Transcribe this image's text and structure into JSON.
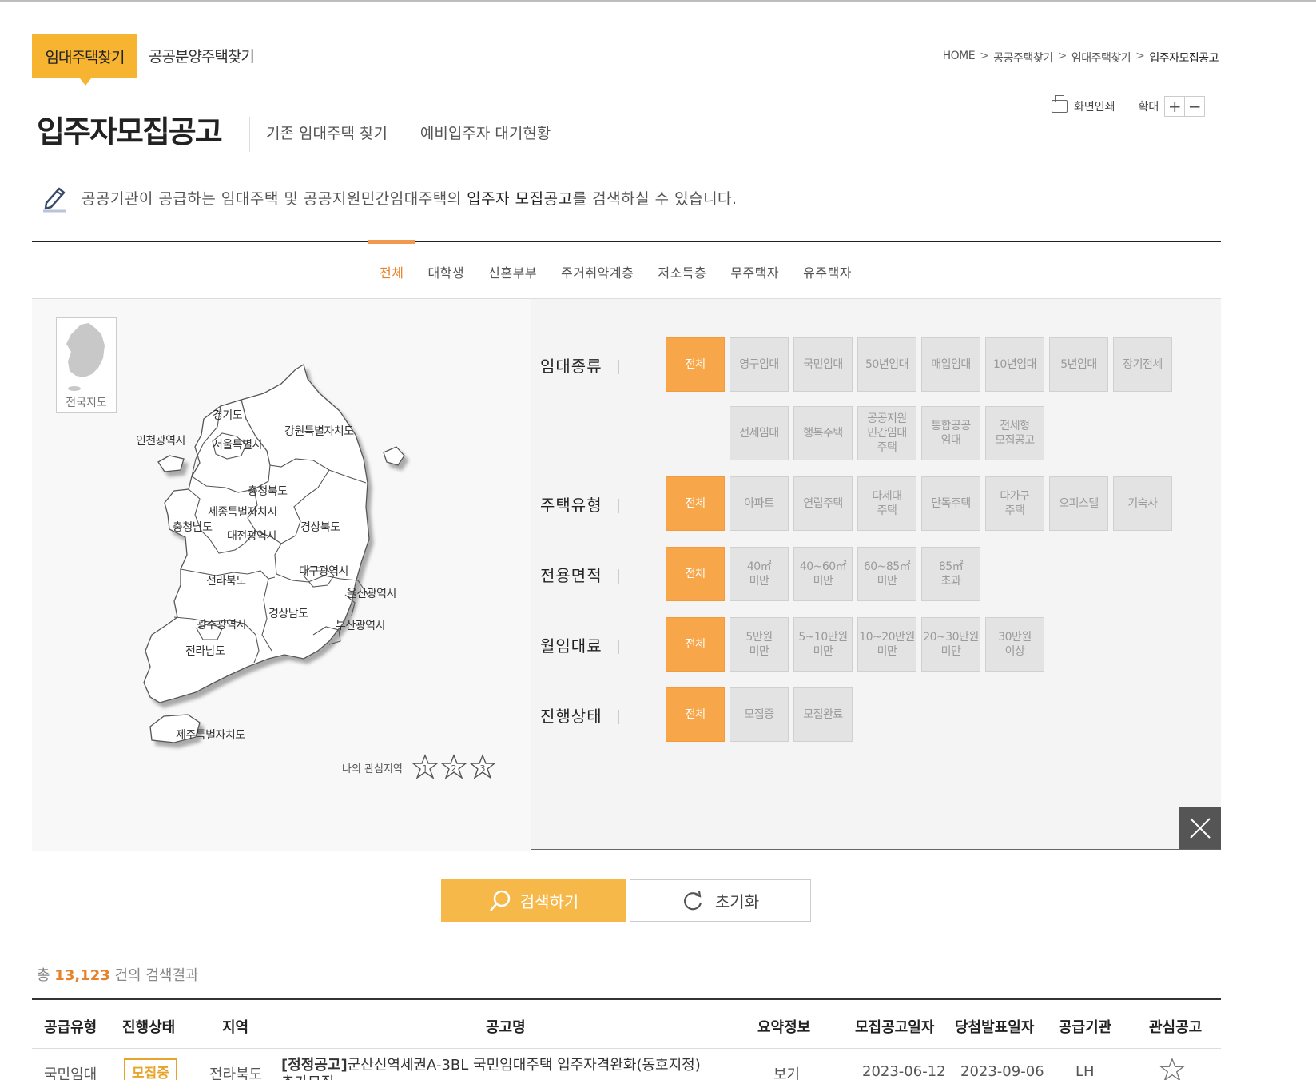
{
  "gnb": {
    "tab_active": "임대주택찾기",
    "tab_other": "공공분양주택찾기",
    "breadcrumb": [
      "HOME",
      "공공주택찾기",
      "임대주택찾기",
      "입주자모집공고"
    ],
    "breadcrumb_sep": ">"
  },
  "tools": {
    "print": "화면인쇄",
    "zoom": "확대",
    "zoom_in": "+",
    "zoom_out": "−"
  },
  "page_title": "입주자모집공고",
  "sublinks": [
    "기존 임대주택 찾기",
    "예비입주자 대기현황"
  ],
  "description": {
    "pre": "공공기관이 공급하는 임대주택 및 공공지원민간임대주택의 ",
    "bold": "입주자 모집공고",
    "post": "를 검색하실 수 있습니다."
  },
  "target_tabs": [
    "전체",
    "대학생",
    "신혼부부",
    "주거취약계층",
    "저소득층",
    "무주택자",
    "유주택자"
  ],
  "active_target_tab": 0,
  "map": {
    "mini_label": "전국지도",
    "regions": [
      "경기도",
      "인천광역시",
      "서울특별시",
      "강원특별자치도",
      "충청북도",
      "세종특별자치시",
      "충청남도",
      "대전광역시",
      "경상북도",
      "대구광역시",
      "전라북도",
      "울산광역시",
      "경상남도",
      "광주광역시",
      "부산광역시",
      "전라남도",
      "제주특별자치도"
    ],
    "favorites_label": "나의 관심지역",
    "favorite_slots": [
      "1",
      "2",
      "3"
    ]
  },
  "filters": {
    "rent_type": {
      "label": "임대종류",
      "options": [
        "전체",
        "영구임대",
        "국민임대",
        "50년임대",
        "매입임대",
        "10년임대",
        "5년임대",
        "장기전세",
        "전세임대",
        "행복주택",
        "공공지원\n민간임대\n주택",
        "통합공공\n임대",
        "전세형\n모집공고"
      ]
    },
    "house_type": {
      "label": "주택유형",
      "options": [
        "전체",
        "아파트",
        "연립주택",
        "다세대\n주택",
        "단독주택",
        "다가구\n주택",
        "오피스텔",
        "기숙사"
      ]
    },
    "area": {
      "label": "전용면적",
      "options": [
        "전체",
        "40㎡\n미만",
        "40~60㎡\n미만",
        "60~85㎡\n미만",
        "85㎡\n초과"
      ]
    },
    "monthly_rent": {
      "label": "월임대료",
      "options": [
        "전체",
        "5만원\n미만",
        "5~10만원\n미만",
        "10~20만원\n미만",
        "20~30만원\n미만",
        "30만원\n이상"
      ]
    },
    "status": {
      "label": "진행상태",
      "options": [
        "전체",
        "모집중",
        "모집완료"
      ]
    }
  },
  "buttons": {
    "search": "검색하기",
    "reset": "초기화"
  },
  "results": {
    "prefix": "총 ",
    "count": "13,123",
    "suffix": " 건의 검색결과"
  },
  "table": {
    "headers": [
      "공급유형",
      "진행상태",
      "지역",
      "공고명",
      "요약정보",
      "모집공고일자",
      "당첨발표일자",
      "공급기관",
      "관심공고"
    ],
    "rows": [
      {
        "type": "국민임대",
        "status": "모집중",
        "region": "전라북도",
        "title_tag": "[정정공고]",
        "title": "군산신역세권A-3BL 국민임대주택 입주자격완화(동호지정) 추가모집",
        "summary": "보기",
        "post_date": "2023-06-12",
        "result_date": "2023-09-06",
        "agency": "LH"
      }
    ]
  },
  "colors": {
    "accent": "#f7b431",
    "orange": "#f8a64a",
    "highlight": "#e8822a"
  }
}
